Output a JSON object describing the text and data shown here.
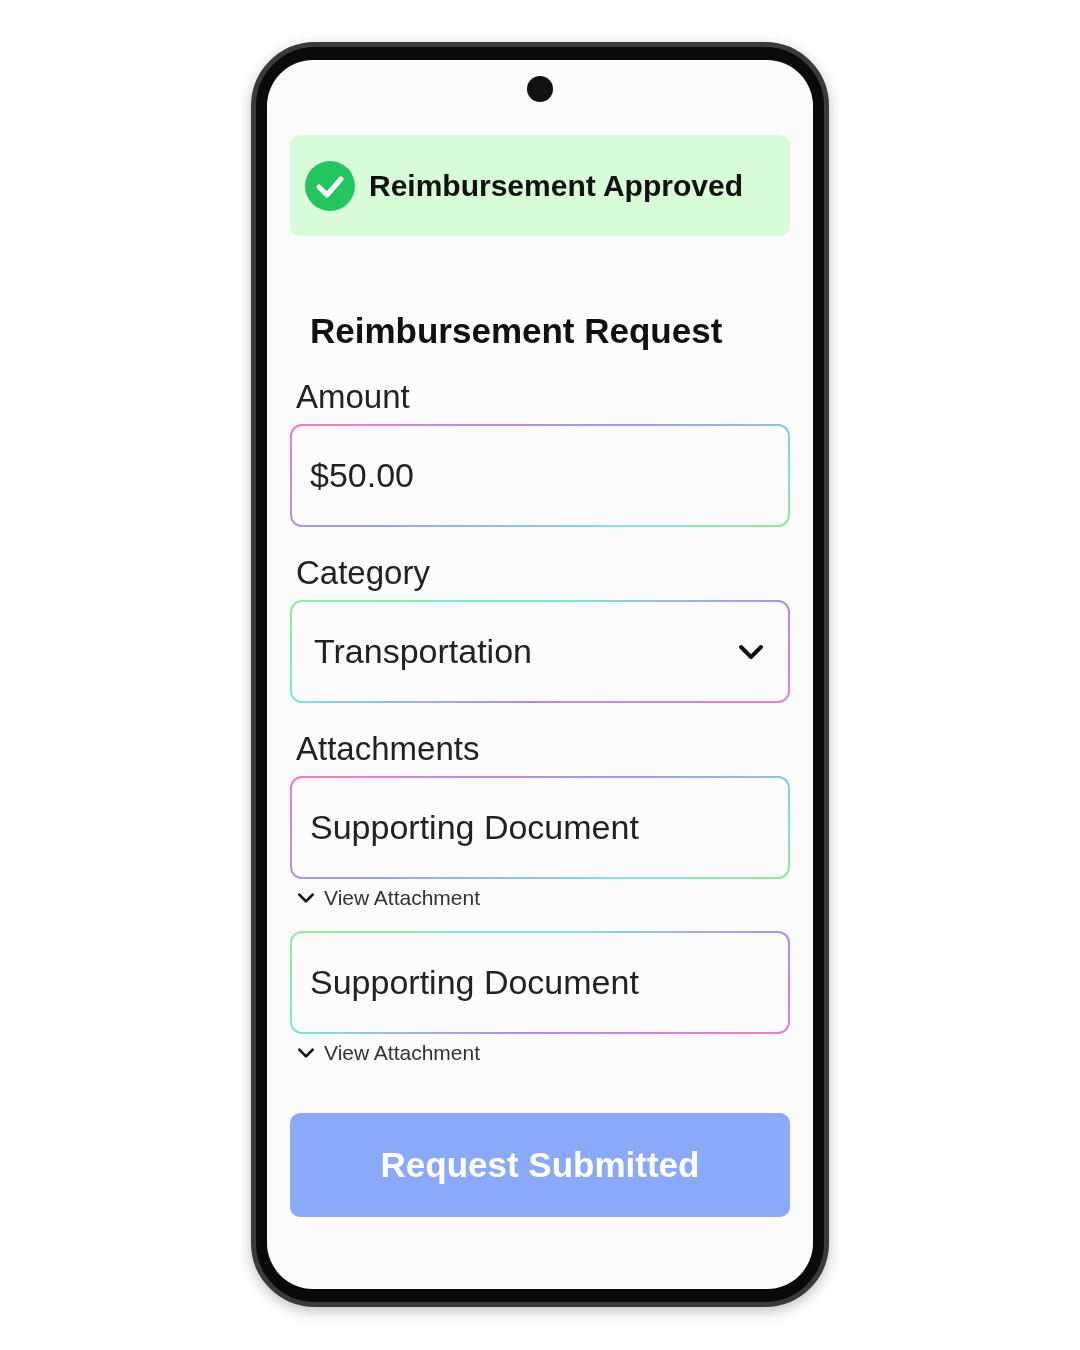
{
  "banner": {
    "kind": "success",
    "text": "Reimbursement Approved"
  },
  "form": {
    "title": "Reimbursement Request",
    "fields": [
      {
        "kind": "text",
        "label": "Amount",
        "value": "$50.00"
      },
      {
        "kind": "select",
        "label": "Category",
        "value": "Transportation"
      },
      {
        "kind": "attachments",
        "label": "Attachments",
        "items": [
          {
            "value": "Supporting Document",
            "link": "View Attachment"
          },
          {
            "value": "Supporting Document",
            "link": "View Attachment"
          }
        ]
      }
    ]
  },
  "button": {
    "label": "Request Submitted",
    "disabled": true
  }
}
